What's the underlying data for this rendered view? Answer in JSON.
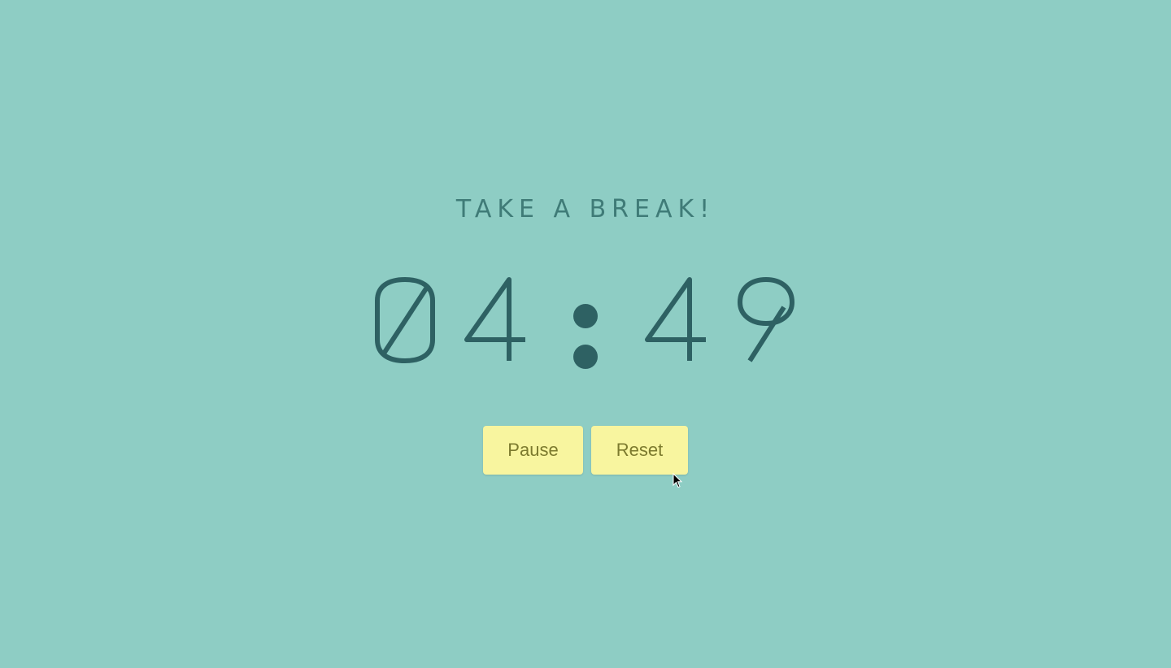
{
  "heading": "TAKE A BREAK!",
  "timer": {
    "display": "04:49",
    "minutes": "04",
    "seconds": "49"
  },
  "controls": {
    "pause_label": "Pause",
    "reset_label": "Reset"
  },
  "colors": {
    "background": "#8ecdc4",
    "digits": "#2e6163",
    "heading": "#3f7b77",
    "button_bg": "#f8f59f",
    "button_text": "#7c7a2e"
  }
}
